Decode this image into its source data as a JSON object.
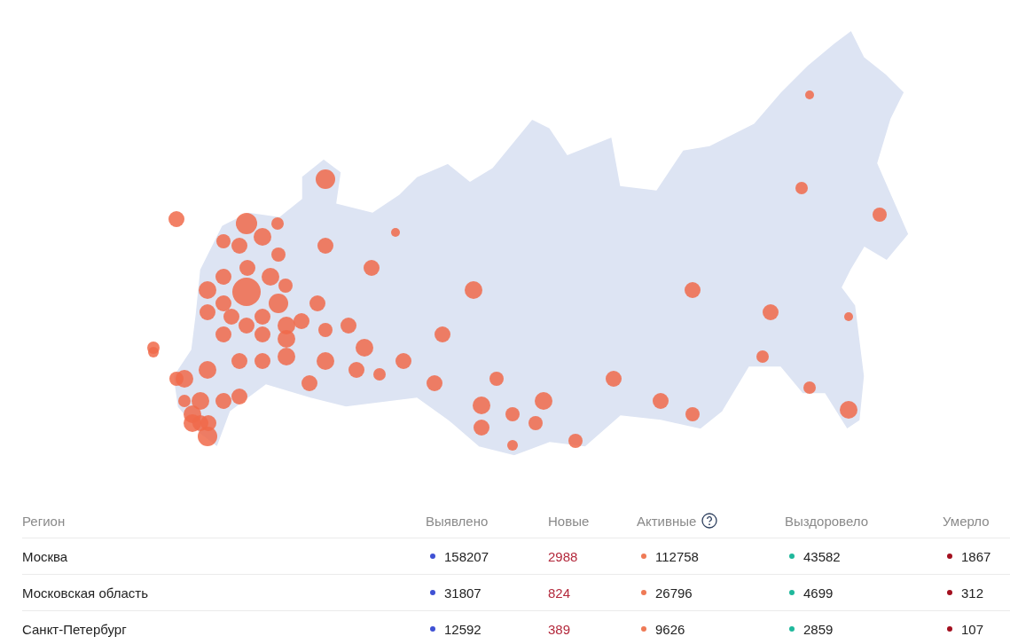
{
  "table": {
    "columns": [
      {
        "label": "Регион",
        "kind": "name"
      },
      {
        "label": "Выявлено",
        "kind": "dot",
        "color": "#3f51d4"
      },
      {
        "label": "Новые",
        "kind": "accent",
        "color": "#b3283b"
      },
      {
        "label": "Активные",
        "kind": "dot",
        "color": "#ef7a56",
        "help": true
      },
      {
        "label": "Выздоровело",
        "kind": "dot",
        "color": "#1fb89c"
      },
      {
        "label": "Умерло",
        "kind": "dot",
        "color": "#a3101f"
      }
    ],
    "rows": [
      {
        "cells": [
          "Москва",
          "158207",
          "2988",
          "112758",
          "43582",
          "1867"
        ]
      },
      {
        "cells": [
          "Московская область",
          "31807",
          "824",
          "26796",
          "4699",
          "312"
        ]
      },
      {
        "cells": [
          "Санкт-Петербург",
          "12592",
          "389",
          "9626",
          "2859",
          "107"
        ]
      }
    ]
  }
}
